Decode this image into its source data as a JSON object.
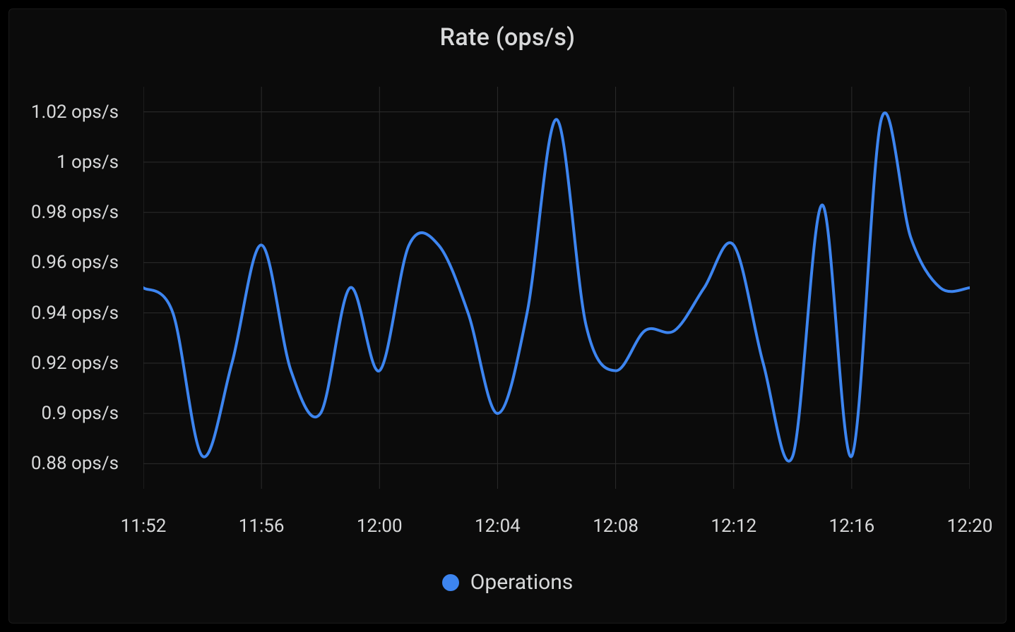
{
  "chart_data": {
    "type": "line",
    "title": "Rate (ops/s)",
    "series": [
      {
        "name": "Operations",
        "color": "#3d85f0",
        "x": [
          "11:52",
          "11:53",
          "11:54",
          "11:55",
          "11:56",
          "11:57",
          "11:58",
          "11:59",
          "12:00",
          "12:01",
          "12:02",
          "12:03",
          "12:04",
          "12:05",
          "12:06",
          "12:07",
          "12:08",
          "12:09",
          "12:10",
          "12:11",
          "12:12",
          "12:13",
          "12:14",
          "12:15",
          "12:16",
          "12:17",
          "12:18",
          "12:19",
          "12:20"
        ],
        "values": [
          0.95,
          0.94,
          0.883,
          0.92,
          0.967,
          0.917,
          0.9,
          0.95,
          0.917,
          0.967,
          0.967,
          0.94,
          0.9,
          0.94,
          1.017,
          0.935,
          0.917,
          0.933,
          0.933,
          0.95,
          0.967,
          0.92,
          0.883,
          0.983,
          0.883,
          1.017,
          0.97,
          0.95,
          0.95
        ]
      }
    ],
    "x_ticks": [
      "11:52",
      "11:56",
      "12:00",
      "12:04",
      "12:08",
      "12:12",
      "12:16",
      "12:20"
    ],
    "y_ticks": [
      0.88,
      0.9,
      0.92,
      0.94,
      0.96,
      0.98,
      1.0,
      1.02
    ],
    "y_tick_labels": [
      "0.88 ops/s",
      "0.9 ops/s",
      "0.92 ops/s",
      "0.94 ops/s",
      "0.96 ops/s",
      "0.98 ops/s",
      "1 ops/s",
      "1.02 ops/s"
    ],
    "xlabel": "",
    "ylabel": "",
    "xlim": [
      "11:52",
      "12:20"
    ],
    "ylim": [
      0.87,
      1.03
    ]
  },
  "legend": {
    "label": "Operations"
  }
}
